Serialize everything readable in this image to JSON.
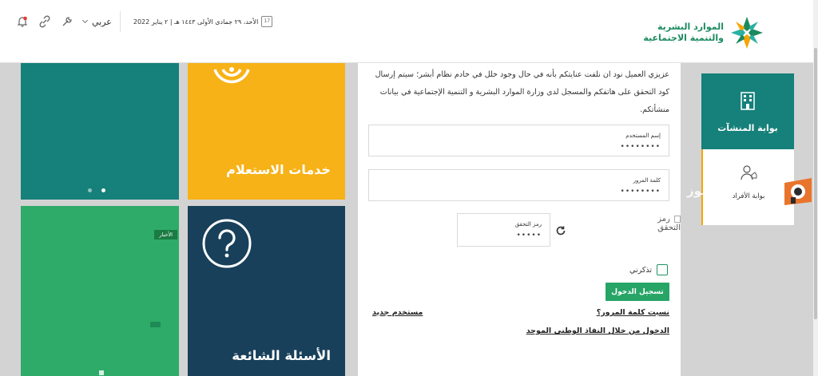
{
  "header": {
    "logo_line1": "الموارد البشرية",
    "logo_line2": "والتنمية الاجتماعية",
    "date": "الأحد، ٢٩ جمادى الأولى ١٤٤٣ هـ | ٢ يناير 2022",
    "calendar_day": "17",
    "language": "عربي",
    "icons": [
      "calendar-icon",
      "tools-icon",
      "link-icon",
      "notification-bell-icon"
    ]
  },
  "sidebar": {
    "items": [
      {
        "label": "بوابة المنشآت",
        "icon": "building-icon"
      },
      {
        "label": "بوابة الأفراد",
        "icon": "person-icon"
      }
    ]
  },
  "login": {
    "intro": "عزيزي العميل نود ان نلفت عنايتكم بأنه في حال وجود خلل في خادم نظام أبشر؛ سيتم إرسال كود التحقق على هاتفكم والمسجل لدى وزارة الموارد البشرية و التنمية الإجتماعية في بيانات منشأتكم.",
    "username_label": "إسم المستخدم",
    "username_value": "••••••••",
    "password_label": "كلمة المرور",
    "password_value": "••••••••",
    "captcha_alt": "رمز التحقق",
    "captcha_label": "رمز التحقق",
    "captcha_value": "•••••",
    "remember_label": "تذكرني",
    "login_button": "تسجيل الدخول",
    "forgot_password": "نسيت كلمة المرور؟",
    "new_user": "مستخدم جديد",
    "national_access": "الدخول من خلال النفاذ الوطني الموحد"
  },
  "tiles": {
    "inquiry_title": "خدمات الاستعلام",
    "faq_title": "الأسئلة الشائعة",
    "news_badge": "الأخبار"
  },
  "watermark": "موز",
  "colors": {
    "teal": "#16807a",
    "yellow": "#f7b217",
    "green": "#2eab69",
    "navy": "#18405a",
    "accent_orange": "#f7a500"
  }
}
